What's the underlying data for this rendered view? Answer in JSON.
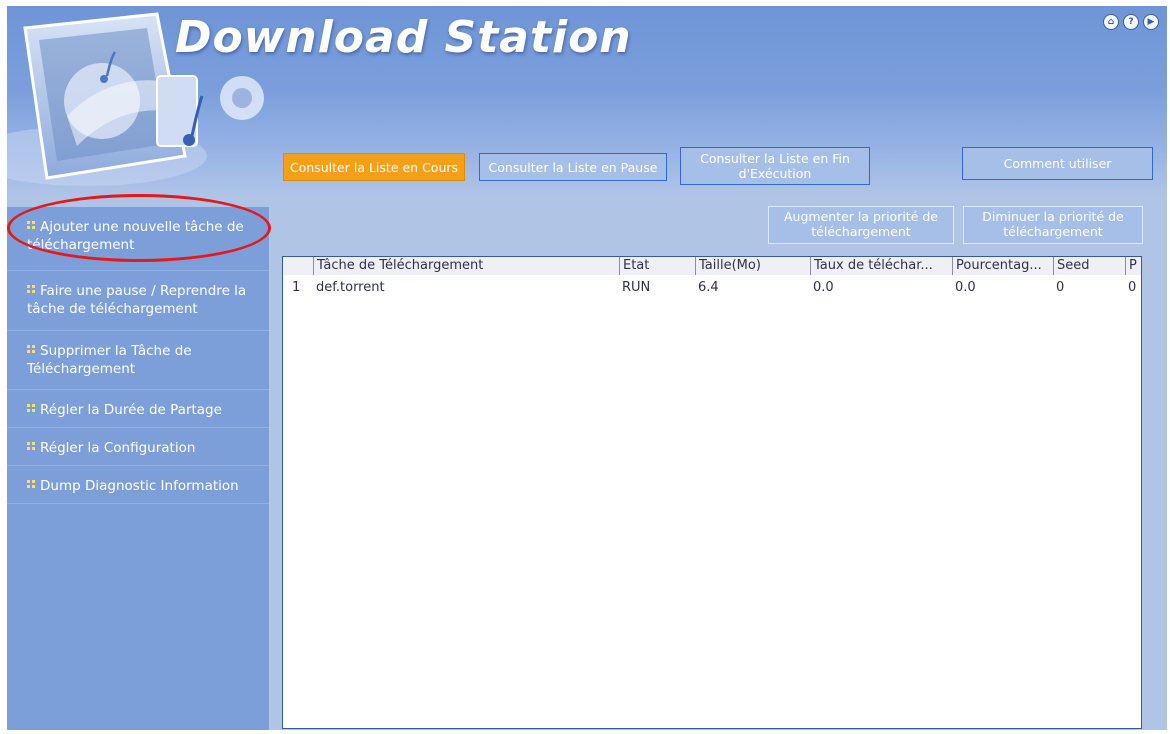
{
  "app": {
    "title": "Download Station",
    "top_icons": [
      "home-icon",
      "help-icon",
      "next-icon"
    ]
  },
  "nav": {
    "running": "Consulter la Liste en Cours",
    "paused": "Consulter la Liste en Pause",
    "finished": "Consulter la Liste en Fin d'Exécution",
    "howto": "Comment utiliser"
  },
  "sidebar": {
    "items": [
      {
        "label": "Ajouter une nouvelle tâche de téléchargement"
      },
      {
        "label": "Faire une pause / Reprendre la tâche de téléchargement"
      },
      {
        "label": "Supprimer la Tâche de Téléchargement"
      },
      {
        "label": "Régler la Durée de Partage"
      },
      {
        "label": "Régler la Configuration"
      },
      {
        "label": "Dump Diagnostic Information"
      }
    ]
  },
  "actions": {
    "increase": "Augmenter la priorité de téléchargement",
    "decrease": "Diminuer la priorité de téléchargement"
  },
  "table": {
    "columns": [
      "",
      "Tâche de Téléchargement",
      "Etat",
      "Taille(Mo)",
      "Taux de téléchar...",
      "Pourcentag...",
      "Seed",
      "P"
    ],
    "rows": [
      [
        "1",
        "def.torrent",
        "RUN",
        "6.4",
        "0.0",
        "0.0",
        "0",
        "0"
      ]
    ]
  },
  "colors": {
    "header": "#7b9fdc",
    "sidebar": "#7d9fd9",
    "active_tab": "#f6a01a",
    "highlight": "#e11a1a"
  }
}
